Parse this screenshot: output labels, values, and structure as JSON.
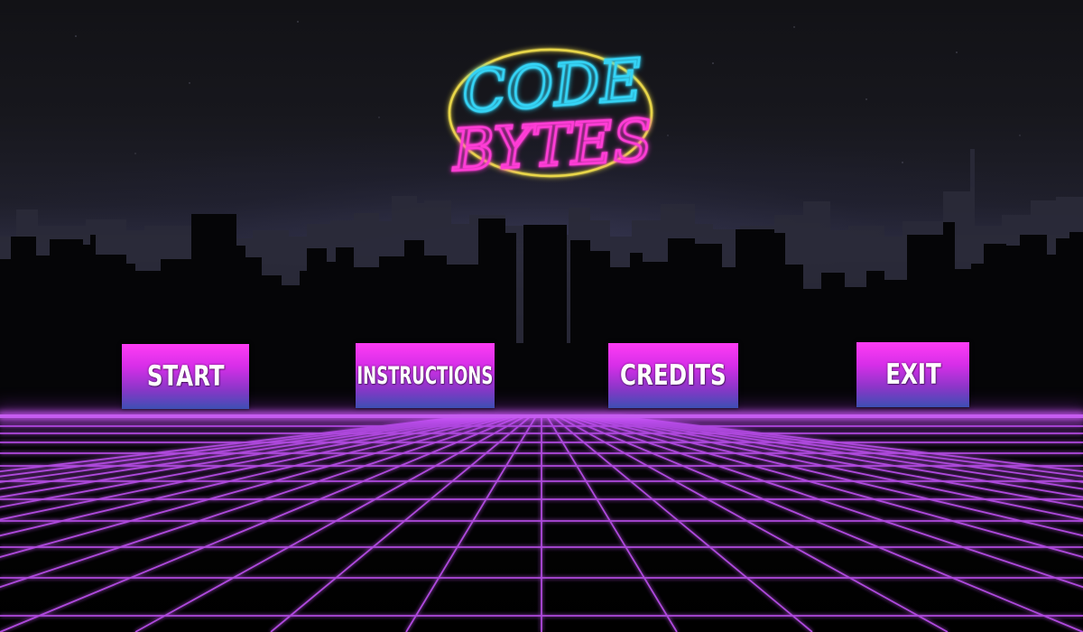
{
  "game": {
    "logo": {
      "line1": "CODE",
      "line2": "BYTES",
      "colors": {
        "line1": "#34d3f5",
        "line2": "#ff3cd6",
        "ring": "#e8d64a"
      }
    },
    "menu": {
      "start_label": "START",
      "instructions_label": "INSTRUCTIONS",
      "credits_label": "CREDITS",
      "exit_label": "EXIT"
    },
    "theme": {
      "button_gradient": [
        "#ff3cf5",
        "#3d4fb4"
      ],
      "grid_color": "#b84ee8",
      "background": "#000000"
    }
  }
}
